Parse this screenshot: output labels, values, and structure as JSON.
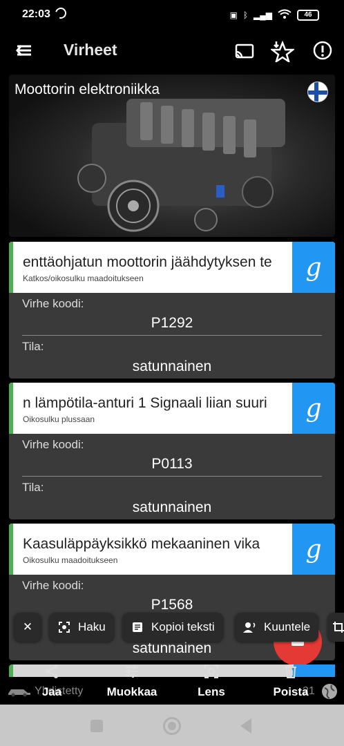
{
  "status": {
    "time": "22:03",
    "battery": "46"
  },
  "appbar": {
    "title": "Virheet"
  },
  "hero": {
    "title": "Moottorin elektroniikka"
  },
  "cards": [
    {
      "name": "enttäohjatun moottorin jäähdytyksen te",
      "sub": "Katkos/oikosulku maadoitukseen",
      "code_label": "Virhe koodi:",
      "code": "P1292",
      "state_label": "Tila:",
      "state": "satunnainen",
      "g": "g"
    },
    {
      "name": "n lämpötila-anturi 1 Signaali liian suuri",
      "sub": "Oikosulku plussaan",
      "code_label": "Virhe koodi:",
      "code": "P0113",
      "state_label": "Tila:",
      "state": "satunnainen",
      "g": "g"
    },
    {
      "name": "Kaasuläppäyksikkö mekaaninen vika",
      "sub": "Oikosulku maadoitukseen",
      "code_label": "Virhe koodi:",
      "code": "P1568",
      "state": "satunnainen",
      "g": "g"
    }
  ],
  "chips": {
    "close": "✕",
    "search": "Haku",
    "copy": "Kopioi teksti",
    "listen": "Kuuntele"
  },
  "bottom": {
    "share": "Jaa",
    "edit": "Muokkaa",
    "lens": "Lens",
    "delete": "Poista",
    "ghost_left": "Yhdistetty",
    "ghost_right": "21"
  },
  "colors": {
    "accent_green": "#4caf50",
    "google_blue": "#2196f3",
    "fab_red": "#e53935"
  }
}
